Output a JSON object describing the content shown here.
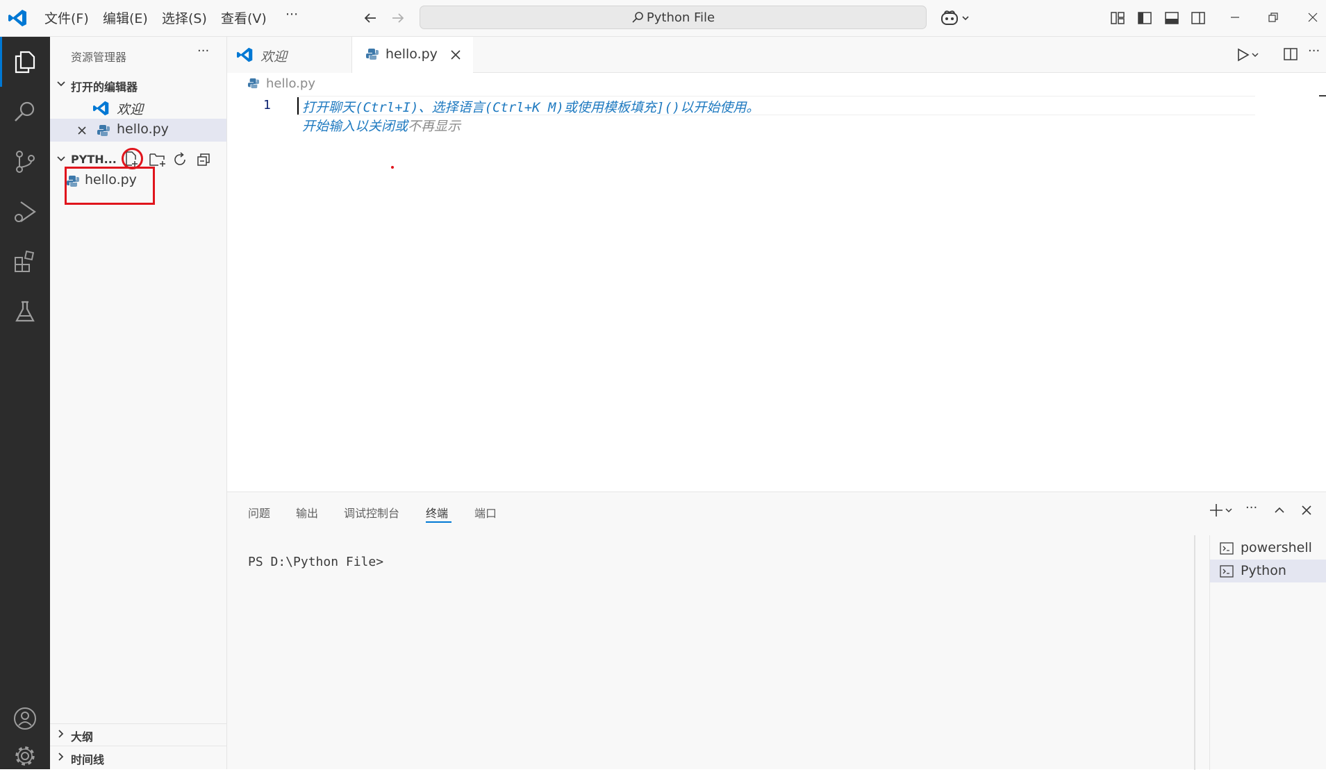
{
  "window": {
    "menu": [
      "文件(F)",
      "编辑(E)",
      "选择(S)",
      "查看(V)",
      "···"
    ],
    "command_center": "Python File"
  },
  "sidebar": {
    "title": "资源管理器",
    "more": "···",
    "open_editors_label": "打开的编辑器",
    "open_editors": [
      "欢迎",
      "hello.py"
    ],
    "folder_label": "PYTH...",
    "files": [
      "hello.py"
    ],
    "outline_label": "大纲",
    "timeline_label": "时间线"
  },
  "tabs": [
    {
      "label": "欢迎",
      "active": false
    },
    {
      "label": "hello.py",
      "active": true
    }
  ],
  "editor": {
    "breadcrumb": "hello.py",
    "line_number": "1",
    "hint_line1_a": "打开聊天(Ctrl+I)、选择语言(Ctrl+K M)或使用模板填充](",
    "hint_line1_b": ")",
    "hint_line1_c": "以开始使用。",
    "hint_line2_a": "开始输入以关闭或",
    "hint_line2_b": "不再显示"
  },
  "panel": {
    "tabs": [
      "问题",
      "输出",
      "调试控制台",
      "终端",
      "端口"
    ],
    "active_tab": "终端",
    "prompt": "PS D:\\Python File>",
    "terminals": [
      "powershell",
      "Python"
    ]
  },
  "colors": {
    "accent": "#0078d4",
    "highlight_red": "#e0151d",
    "hint_blue": "#1f7ac0",
    "hint_gray": "#8b8b8b"
  }
}
